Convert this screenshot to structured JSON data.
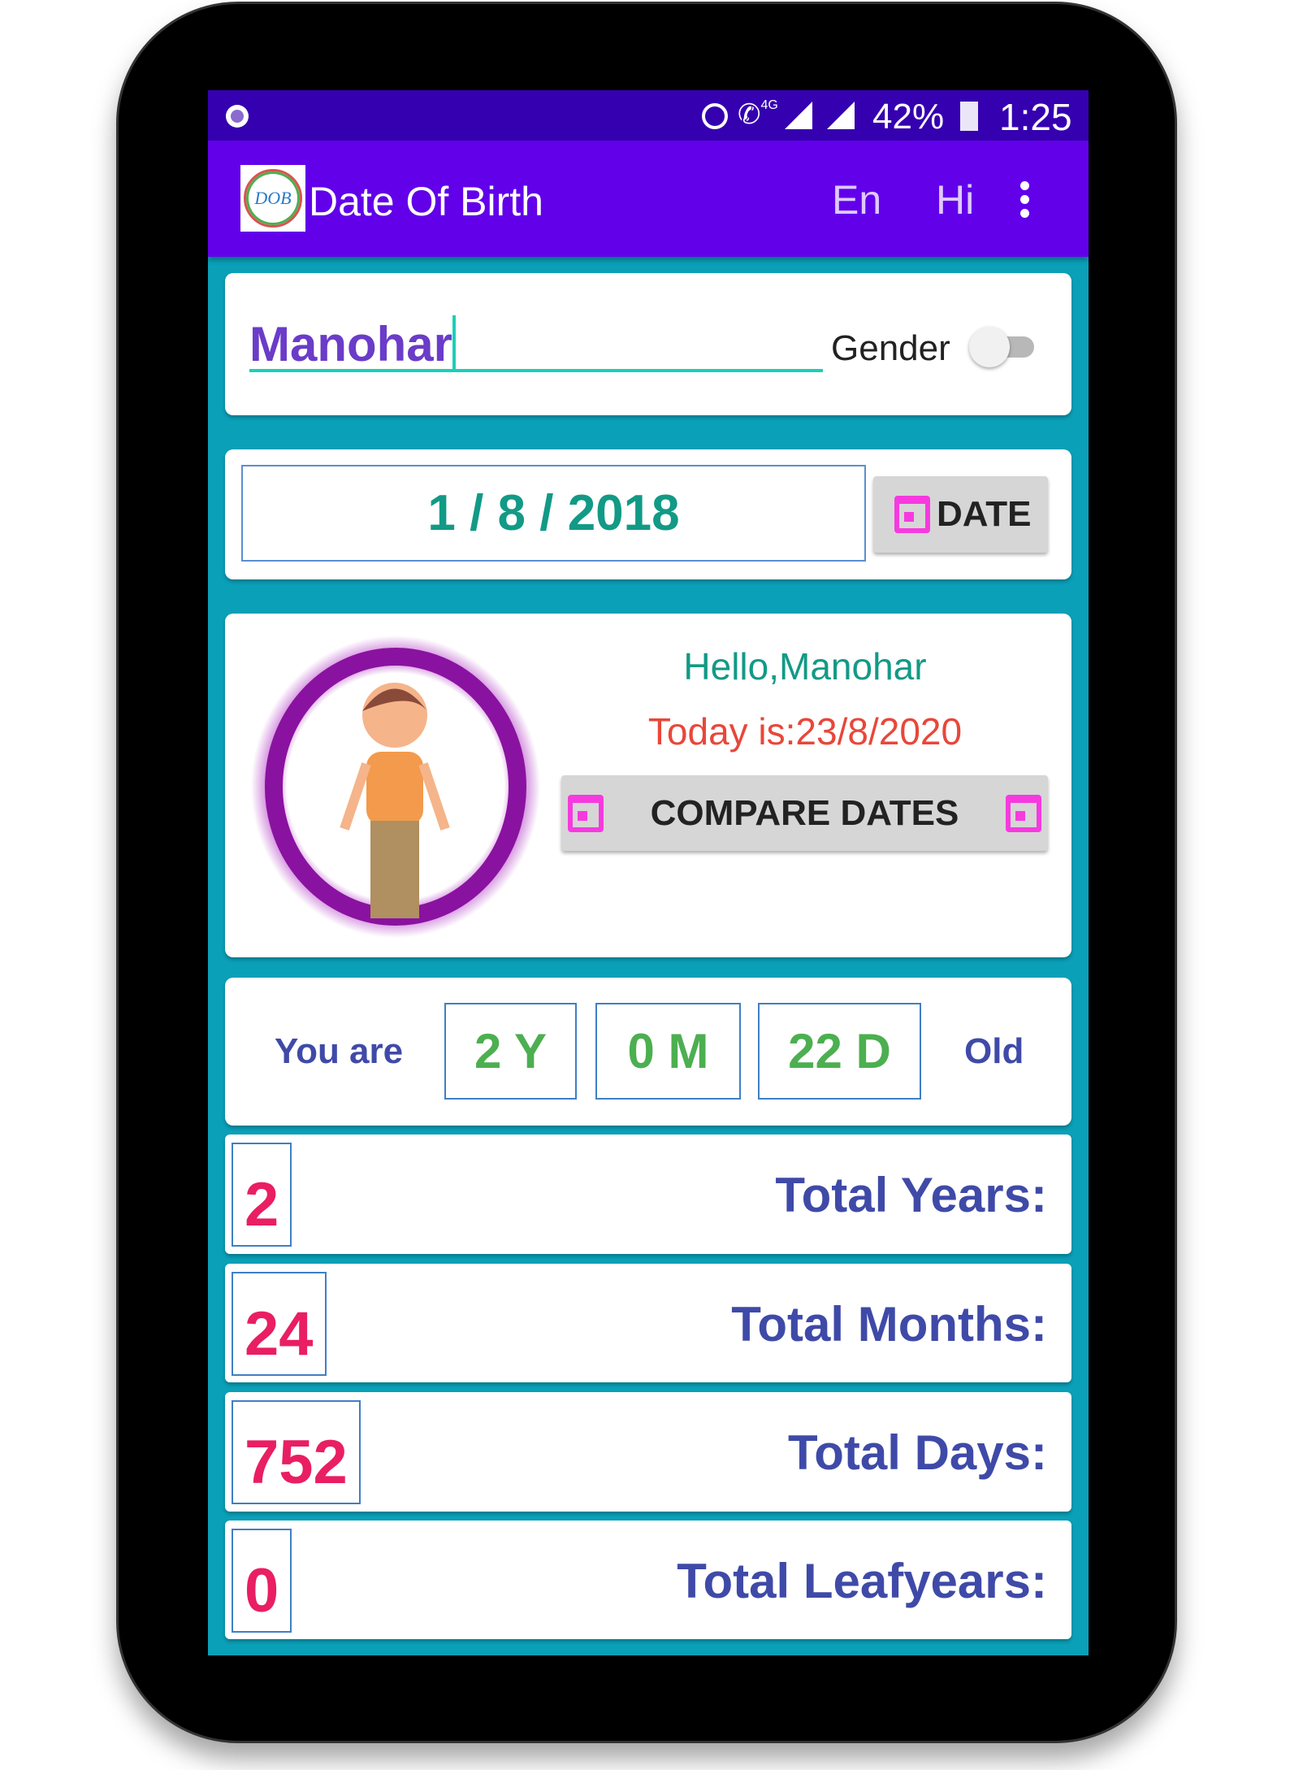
{
  "status_bar": {
    "battery": "42%",
    "time": "1:25",
    "network": "4G",
    "icons": [
      "record-icon",
      "alarm-icon",
      "call-icon",
      "signal-icon",
      "signal-icon",
      "battery-charging-icon"
    ]
  },
  "toolbar": {
    "logo_text": "DOB",
    "title": "Date Of Birth",
    "lang_en": "En",
    "lang_hi": "Hi",
    "menu_icon": "more-vert-icon"
  },
  "name_card": {
    "name_value": "Manohar",
    "gender_label": "Gender",
    "gender_toggle_on": false
  },
  "date_card": {
    "dob_value": "1 / 8 / 2018",
    "date_button": "DATE"
  },
  "greeting_card": {
    "hello": "Hello,Manohar",
    "today": "Today is:23/8/2020",
    "compare_button": "COMPARE DATES"
  },
  "age_card": {
    "prefix": "You are",
    "years": "2 Y",
    "months": "0 M",
    "days": "22 D",
    "suffix": "Old"
  },
  "totals": [
    {
      "value": "2",
      "label": "Total Years:"
    },
    {
      "value": "24",
      "label": "Total Months:"
    },
    {
      "value": "752",
      "label": "Total Days:"
    },
    {
      "value": "0",
      "label": "Total Leafyears:"
    }
  ],
  "colors": {
    "status_bar": "#3500b0",
    "toolbar": "#6200ea",
    "background": "#0aa0b8",
    "accent_pink": "#f63adf",
    "number_red": "#e91e63",
    "label_blue": "#3f4aa8",
    "age_green": "#4caf50"
  }
}
